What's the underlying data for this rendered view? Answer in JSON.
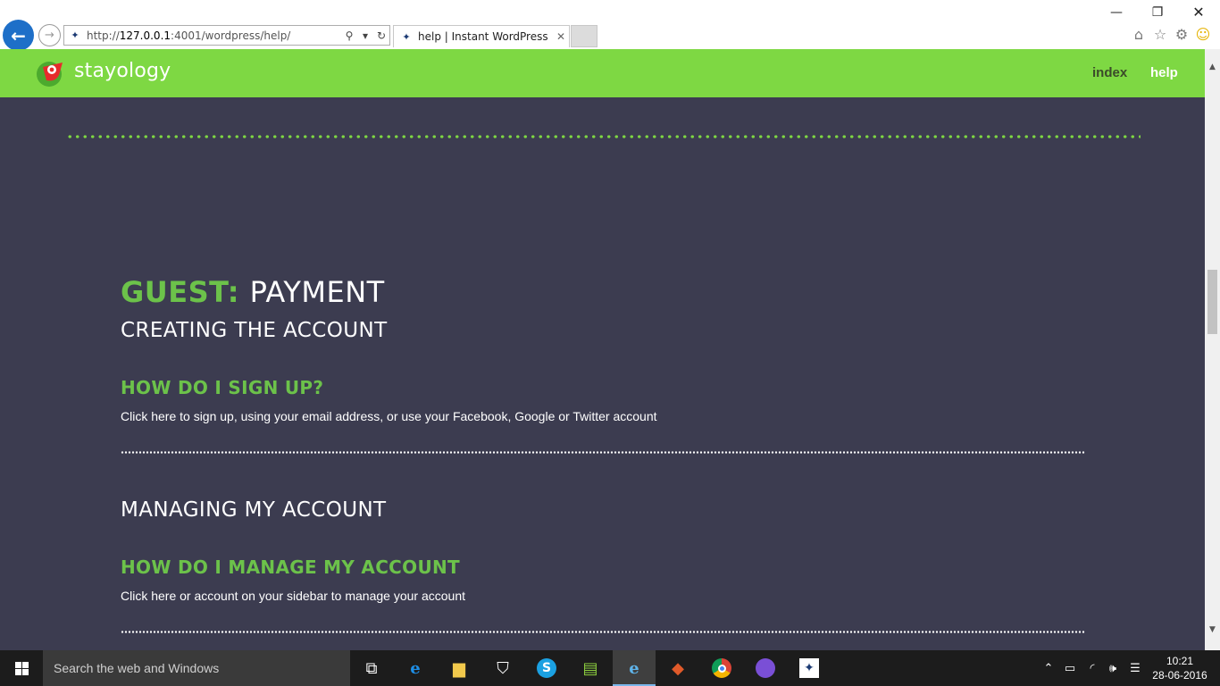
{
  "browser": {
    "url_scheme": "http://",
    "url_host": "127.0.0.1",
    "url_rest": ":4001/wordpress/help/",
    "tab_title": "help | Instant WordPress",
    "icons": [
      "back-arrow-icon",
      "forward-arrow-icon",
      "search-icon",
      "refresh-icon",
      "close-icon",
      "home-icon",
      "star-icon",
      "gear-icon",
      "smiley-icon"
    ]
  },
  "site": {
    "logo_text": "stayology",
    "nav": {
      "index": "index",
      "help": "help"
    },
    "colors": {
      "header_green": "#7ed843",
      "accent_green": "#6cc24a",
      "background": "#3c3c50"
    }
  },
  "content": {
    "title_prefix": "GUEST:",
    "title_main": "PAYMENT",
    "section1": {
      "title": "CREATING THE ACCOUNT",
      "question": "HOW DO I SIGN UP?",
      "answer": "Click here to sign up, using your email address, or use your Facebook, Google or Twitter account"
    },
    "section2": {
      "title": "MANAGING MY ACCOUNT",
      "question": "HOW DO I MANAGE MY ACCOUNT",
      "answer": "Click here or account on your sidebar to manage your account"
    }
  },
  "taskbar": {
    "search_placeholder": "Search the web and Windows",
    "time": "10:21",
    "date": "28-06-2016",
    "apps": [
      "task-view-icon",
      "edge-icon",
      "file-explorer-icon",
      "store-icon",
      "skype-icon",
      "notepad-icon",
      "internet-explorer-icon",
      "git-icon",
      "chrome-icon",
      "github-icon",
      "instant-wordpress-icon"
    ]
  }
}
